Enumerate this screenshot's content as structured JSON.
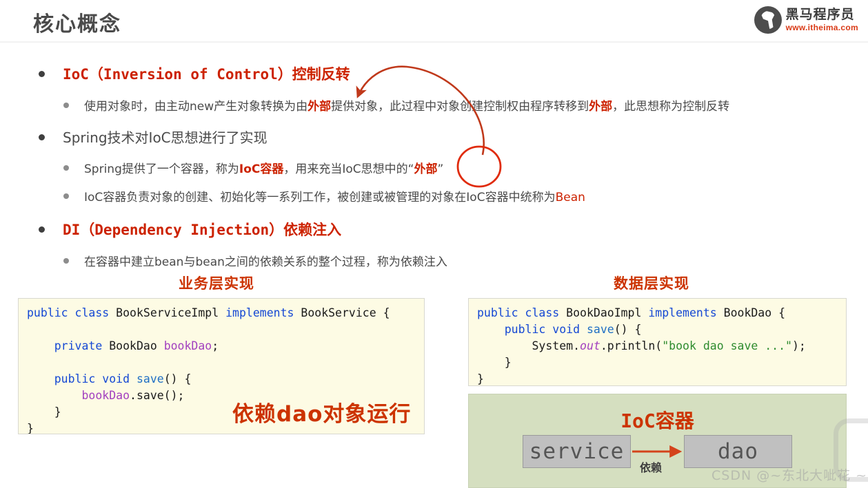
{
  "header": {
    "title": "核心概念",
    "logo_cn": "黑马程序员",
    "logo_url": "www.itheima.com",
    "logo_icon": "horse-circle-icon"
  },
  "bullets": {
    "ioc_heading": {
      "code": "IoC（Inversion of Control）",
      "cn": "控制反转"
    },
    "ioc_detail": {
      "p1": "使用对象时，由主动new产生对象转换为由",
      "h1": "外部",
      "p2": "提供对象，此过程中对象创建控制权由程序转移到",
      "h2": "外部",
      "p3": "，此思想称为控制反转"
    },
    "spring_heading": "Spring技术对IoC思想进行了实现",
    "spring_detail_1": {
      "p1": "Spring提供了一个容器，称为",
      "h1": "IoC容器",
      "p2": "，用来充当IoC思想中的“",
      "h2": "外部",
      "p3": "”"
    },
    "spring_detail_2": {
      "p1": "IoC容器负责对象的创建、初始化等一系列工作，被创建或被管理的对象在IoC容器中统称为",
      "h1": "Bean"
    },
    "di_heading": {
      "code": "DI（Dependency Injection）",
      "cn": "依赖注入"
    },
    "di_detail": "在容器中建立bean与bean之间的依赖关系的整个过程，称为依赖注入"
  },
  "service_section": {
    "title": "业务层实现",
    "code_line_1_kw1": "public",
    "code_line_1_kw2": "class",
    "code_line_1_name": " BookServiceImpl ",
    "code_line_1_kw3": "implements",
    "code_line_1_iface": " BookService {",
    "code_line_3_kw": "    private",
    "code_line_3_type": " BookDao ",
    "code_line_3_field": "bookDao",
    "code_line_3_end": ";",
    "code_line_5_kw1": "    public",
    "code_line_5_kw2": " void",
    "code_line_5_mth": " save",
    "code_line_5_end": "() {",
    "code_line_6_field": "        bookDao",
    "code_line_6_end": ".save();",
    "code_line_7": "    }",
    "code_line_8": "}",
    "overlay_note": "依赖dao对象运行"
  },
  "dao_section": {
    "title": "数据层实现",
    "code_line_1_kw1": "public",
    "code_line_1_kw2": " class",
    "code_line_1_name": " BookDaoImpl ",
    "code_line_1_kw3": "implements",
    "code_line_1_iface": " BookDao {",
    "code_line_2_kw1": "    public",
    "code_line_2_kw2": " void",
    "code_line_2_mth": " save",
    "code_line_2_end": "() {",
    "code_line_3_a": "        System.",
    "code_line_3_out": "out",
    "code_line_3_b": ".println(",
    "code_line_3_str": "\"book dao save ...\"",
    "code_line_3_c": ");",
    "code_line_4": "    }",
    "code_line_5": "}"
  },
  "ioc_container": {
    "title": "IoC容器",
    "node_service": "service",
    "node_dao": "dao",
    "arrow_label": "依赖"
  },
  "watermark": {
    "text": "CSDN @~东北大呲花 ~"
  },
  "colors": {
    "accent_red": "#cc2200",
    "title_gray": "#4a4a4a",
    "code_bg": "#fdfbe4",
    "container_green": "#d5dfc0",
    "node_gray": "#c0c0c0",
    "keyword_blue": "#1548d4",
    "field_purple": "#a23fbf",
    "string_green": "#2e8b2e"
  }
}
